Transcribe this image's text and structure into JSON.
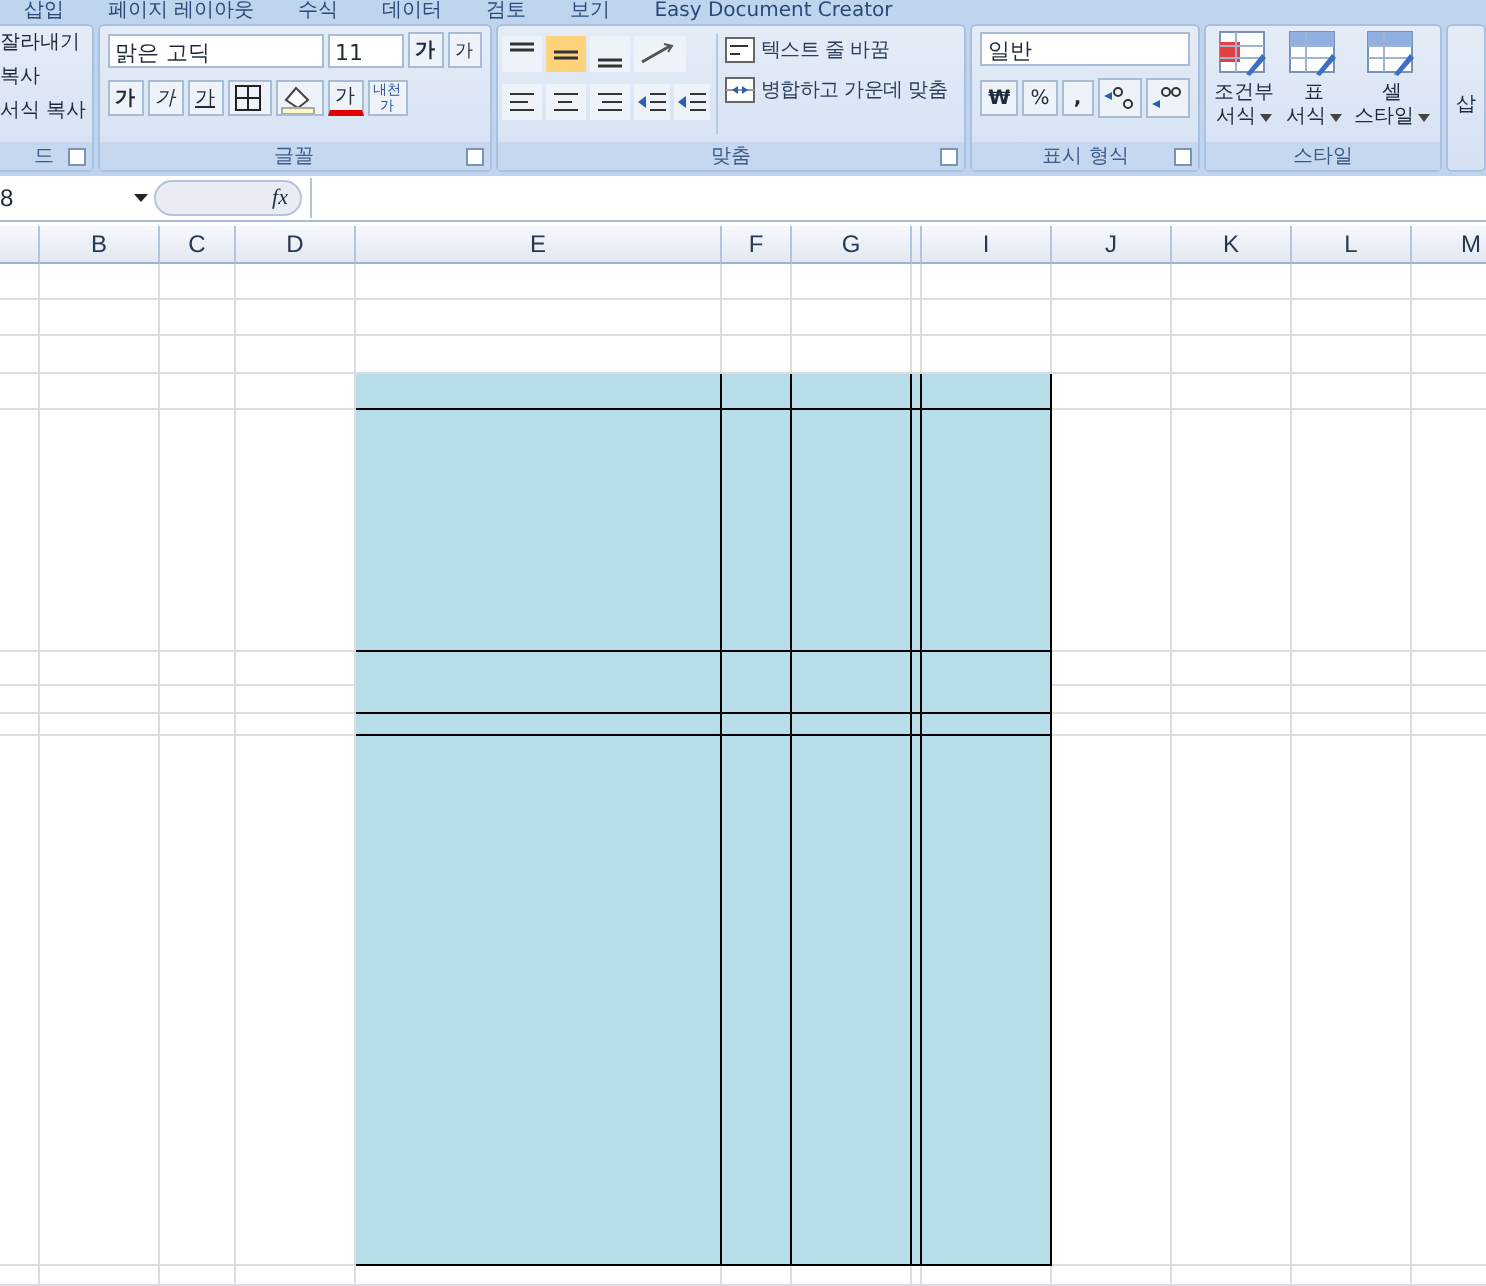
{
  "ribbon_tabs": [
    "삽입",
    "페이지 레이아웃",
    "수식",
    "데이터",
    "검토",
    "보기",
    "Easy Document Creator"
  ],
  "clipboard": {
    "items": [
      "잘라내기",
      "복사",
      "서식 복사"
    ],
    "label": "드"
  },
  "font": {
    "name": "맑은 고딕",
    "size": "11",
    "grow": "가",
    "shrink": "가",
    "bold": "가",
    "italic": "가",
    "underline": "가",
    "font_color": "가",
    "phonetic": "내천",
    "phonetic_sub": "가",
    "label": "글꼴"
  },
  "alignment": {
    "vertical": [
      {
        "selected": false
      },
      {
        "selected": true
      },
      {
        "selected": false
      }
    ],
    "wrap_text": "텍스트 줄 바꿈",
    "merge_center": "병합하고 가운데 맞춤",
    "label": "맞춤"
  },
  "number": {
    "format": "일반",
    "currency": "₩",
    "percent": "%",
    "comma": ",",
    "label": "표시 형식"
  },
  "styles": {
    "buttons": [
      {
        "line1": "조건부",
        "line2": "서식"
      },
      {
        "line1": "표",
        "line2": "서식"
      },
      {
        "line1": "셀",
        "line2": "스타일"
      }
    ],
    "label": "스타일"
  },
  "cells_group": {
    "partial": "삽"
  },
  "formula_bar": {
    "name_box": "8",
    "fx": "fx"
  },
  "columns": [
    "B",
    "C",
    "D",
    "E",
    "F",
    "G",
    "I",
    "J",
    "K",
    "L",
    "M"
  ]
}
